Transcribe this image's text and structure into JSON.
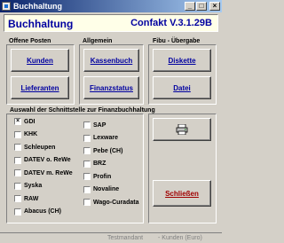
{
  "window": {
    "title": "Buchhaltung"
  },
  "header": {
    "title": "Buchhaltung",
    "version": "Confakt V.3.1.29B"
  },
  "groups": {
    "offene_posten": {
      "label": "Offene Posten",
      "buttons": [
        "Kunden",
        "Lieferanten"
      ]
    },
    "allgemein": {
      "label": "Allgemein",
      "buttons": [
        "Kassenbuch",
        "Finanzstatus"
      ]
    },
    "fibu": {
      "label": "Fibu - Übergabe",
      "buttons": [
        "Diskette",
        "Datei"
      ]
    },
    "schnittstelle": {
      "label": "Auswahl der Schnittstelle zur Finanzbuchhaltung",
      "col1": [
        "GDI",
        "KHK",
        "Schleupen",
        "DATEV o. ReWe",
        "DATEV m. ReWe",
        "Syska",
        "RAW",
        "Abacus (CH)"
      ],
      "col2": [
        "SAP",
        "Lexware",
        "Pebe (CH)",
        "BRZ",
        "Profin",
        "Novaline",
        "Wago-Curadata"
      ],
      "checked": "GDI"
    }
  },
  "actions": {
    "print_icon": "printer-icon",
    "close_label": "Schließen"
  },
  "status": {
    "mandant": "Testmandant",
    "mode": "- Kunden (Euro)"
  }
}
